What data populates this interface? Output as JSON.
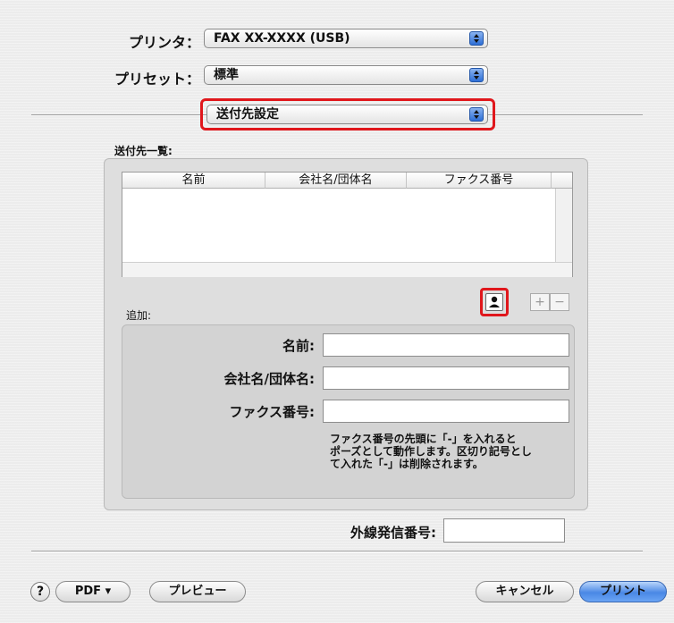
{
  "printer": {
    "label": "プリンタ：",
    "value": "FAX XX-XXXX (USB)"
  },
  "preset": {
    "label": "プリセット：",
    "value": "標準"
  },
  "panel": {
    "value": "送付先設定"
  },
  "recipients": {
    "title": "送付先一覧:",
    "columns": [
      "名前",
      "会社名/団体名",
      "ファクス番号"
    ],
    "rows": []
  },
  "add": {
    "title": "追加:",
    "name_label": "名前:",
    "company_label": "会社名/団体名:",
    "fax_label": "ファクス番号:",
    "note_lines": [
      "ファクス番号の先頭に「-」を入れると",
      "ポーズとして動作します。区切り記号とし",
      "て入れた「-」は削除されます。"
    ],
    "plus": "+",
    "minus": "−"
  },
  "outside_line": {
    "label": "外線発信番号:",
    "value": ""
  },
  "footer": {
    "help": "?",
    "pdf": "PDF ▾",
    "preview": "プレビュー",
    "cancel": "キャンセル",
    "print": "プリント"
  },
  "colors": {
    "highlight": "#e0171c",
    "accent": "#4a88e5"
  }
}
